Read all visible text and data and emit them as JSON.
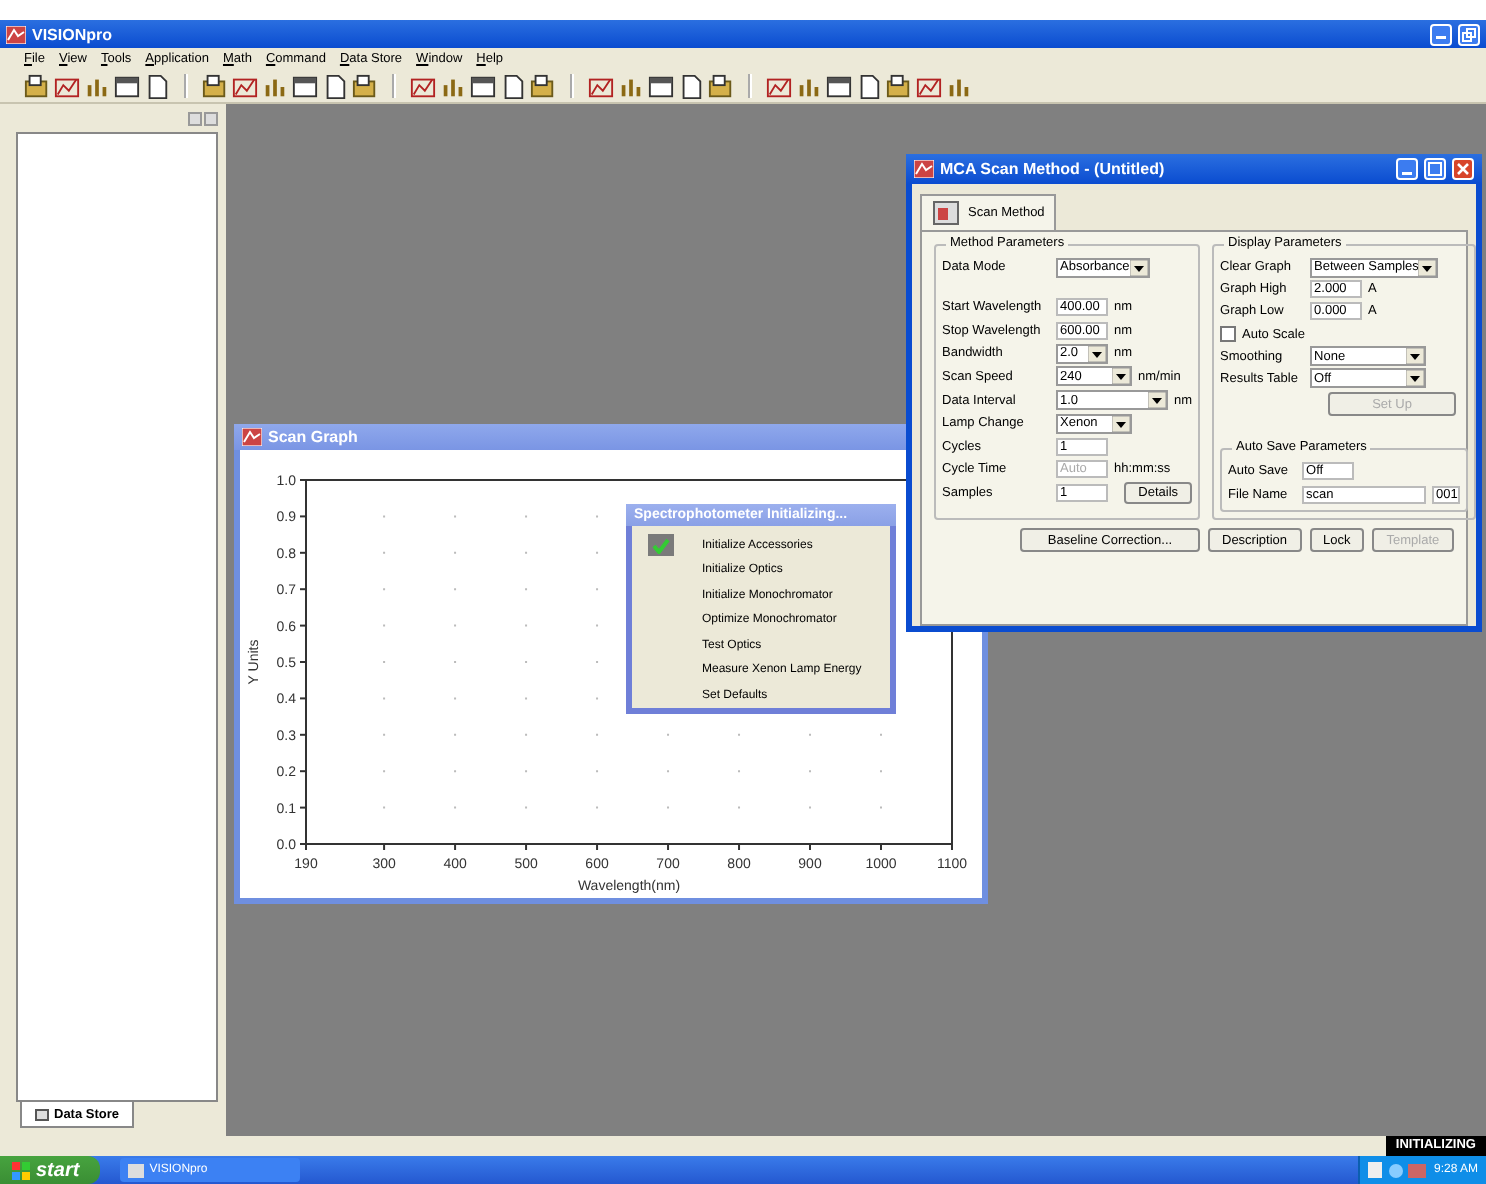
{
  "app": {
    "title": "VISIONpro"
  },
  "menu": [
    "File",
    "View",
    "Tools",
    "Application",
    "Math",
    "Command",
    "Data Store",
    "Window",
    "Help"
  ],
  "data_store_tab": {
    "label": "Data Store",
    "selected": true
  },
  "mca_window": {
    "title": "MCA Scan Method - (Untitled)",
    "tab": {
      "label": "Scan Method",
      "selected": true
    },
    "method_parameters": {
      "title": "Method Parameters",
      "rows": [
        {
          "kind": "dropdown",
          "label": "Data Mode",
          "value": "Absorbance"
        },
        {
          "kind": "text",
          "label": "Start Wavelength",
          "value": "400.00",
          "unit": "nm",
          "disabled": false
        },
        {
          "kind": "text",
          "label": "Stop Wavelength",
          "value": "600.00",
          "unit": "nm",
          "disabled": false
        },
        {
          "kind": "dropdown",
          "label": "Bandwidth",
          "value": "2.0",
          "unit": "nm"
        },
        {
          "kind": "dropdown",
          "label": "Scan Speed",
          "value": "240",
          "unit": "nm/min"
        },
        {
          "kind": "dropdown",
          "label": "Data Interval",
          "value": "1.0",
          "unit": "nm"
        },
        {
          "kind": "dropdown",
          "label": "Lamp Change",
          "value": "Xenon"
        },
        {
          "kind": "text",
          "label": "Cycles",
          "value": "1",
          "disabled": false
        },
        {
          "kind": "text",
          "label": "Cycle Time",
          "value": "Auto",
          "unit": "hh:mm:ss",
          "disabled": true
        },
        {
          "kind": "text",
          "label": "Samples",
          "value": "1",
          "disabled": false,
          "button": "Details"
        }
      ]
    },
    "display_parameters": {
      "title": "Display Parameters",
      "rows": [
        {
          "kind": "dropdown",
          "label": "Clear Graph",
          "value": "Between Samples"
        },
        {
          "kind": "text",
          "label": "Graph High",
          "value": "2.000",
          "unit": "A",
          "disabled": false
        },
        {
          "kind": "text",
          "label": "Graph Low",
          "value": "0.000",
          "unit": "A",
          "disabled": false
        },
        {
          "kind": "checkbox",
          "label": "Auto Scale",
          "checked": false
        },
        {
          "kind": "dropdown",
          "label": "Smoothing",
          "value": "None"
        },
        {
          "kind": "dropdown",
          "label": "Results Table",
          "value": "Off"
        },
        {
          "kind": "button",
          "label": "Set Up",
          "disabled": true
        }
      ]
    },
    "auto_save_parameters": {
      "title": "Auto Save Parameters",
      "rows": [
        {
          "kind": "text",
          "label": "Auto Save",
          "value": "Off",
          "disabled": false
        },
        {
          "kind": "text",
          "label": "File Name",
          "value": "scan",
          "suffix": "001",
          "disabled": false
        }
      ]
    },
    "buttons": [
      {
        "label": "Baseline Correction...",
        "disabled": false
      },
      {
        "label": "Description",
        "disabled": false
      },
      {
        "label": "Lock",
        "disabled": false
      },
      {
        "label": "Template",
        "disabled": true
      }
    ]
  },
  "scan_graph": {
    "title": "Scan Graph",
    "chart_data": {
      "type": "line",
      "grid": true,
      "xlabel": "Wavelength(nm)",
      "ylabel": "Y Units",
      "xlim": [
        190,
        1100
      ],
      "ylim": [
        0,
        1
      ],
      "xticks": [
        190,
        300,
        400,
        500,
        600,
        700,
        800,
        900,
        1000,
        1100
      ],
      "yticks": [
        {
          "value": 0,
          "label": "0.0"
        },
        {
          "value": 0.1,
          "label": "0.1"
        },
        {
          "value": 0.2,
          "label": "0.2"
        },
        {
          "value": 0.3,
          "label": "0.3"
        },
        {
          "value": 0.4,
          "label": "0.4"
        },
        {
          "value": 0.5,
          "label": "0.5"
        },
        {
          "value": 0.6,
          "label": "0.6"
        },
        {
          "value": 0.7,
          "label": "0.7"
        },
        {
          "value": 0.8,
          "label": "0.8"
        },
        {
          "value": 0.9,
          "label": "0.9"
        },
        {
          "value": 1,
          "label": "1.0"
        }
      ]
    }
  },
  "init_dialog": {
    "title": "Spectrophotometer Initializing...",
    "steps": [
      {
        "label": "Initialize Accessories",
        "done": true
      },
      {
        "label": "Initialize Optics",
        "done": false
      },
      {
        "label": "Initialize Monochromator",
        "done": false
      },
      {
        "label": "Optimize Monochromator",
        "done": false
      },
      {
        "label": "Test Optics",
        "done": false
      },
      {
        "label": "Measure Xenon Lamp Energy",
        "done": false
      },
      {
        "label": "Set Defaults",
        "done": false
      }
    ]
  },
  "status_bar": {
    "status": "INITIALIZING"
  },
  "taskbar": {
    "start": "start",
    "tasks": [
      {
        "label": "VISIONpro",
        "selected": false
      }
    ],
    "clock": "9:28 AM"
  }
}
